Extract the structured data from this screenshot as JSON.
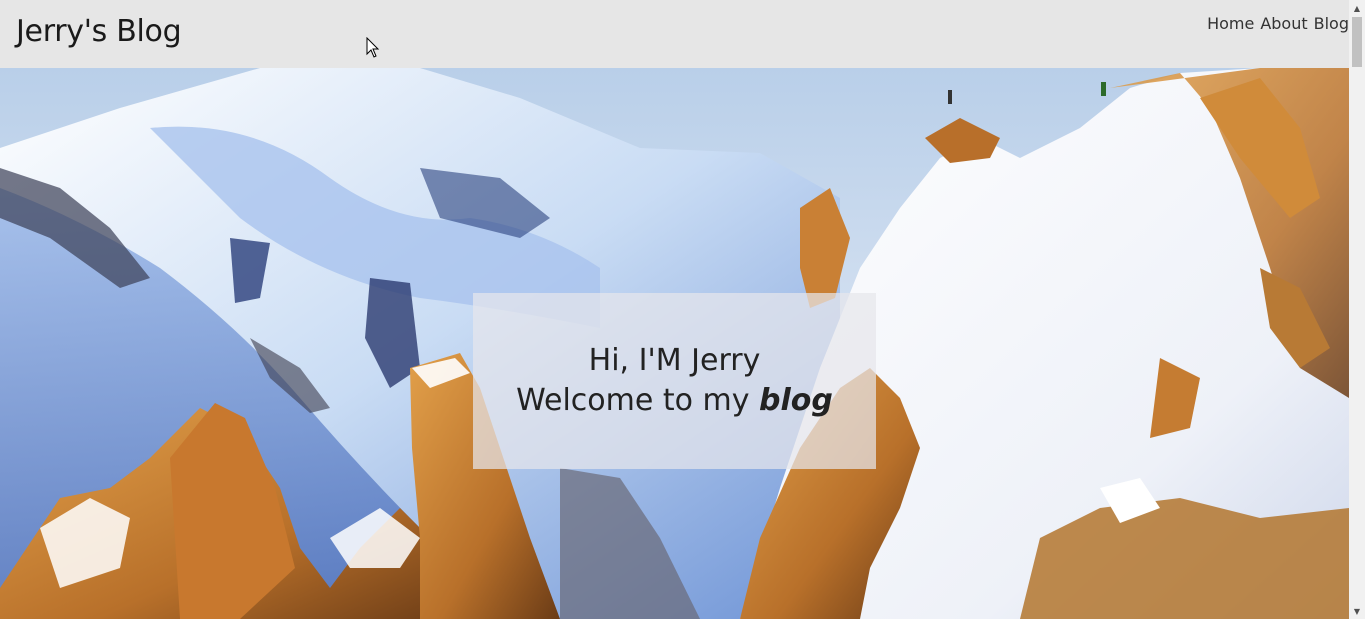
{
  "header": {
    "title": "Jerry's Blog",
    "nav": [
      "Home",
      "About",
      "Blog"
    ]
  },
  "hero": {
    "greeting": "Hi, I'M Jerry",
    "welcome_prefix": "Welcome to my ",
    "welcome_emphasis": "blog"
  },
  "scrollbar": {
    "up_icon": "arrow-up-icon",
    "down_icon": "arrow-down-icon"
  },
  "colors": {
    "header_bg": "#e6e6e6",
    "text": "#1a1a1a",
    "box_bg": "#e6e6eb"
  }
}
